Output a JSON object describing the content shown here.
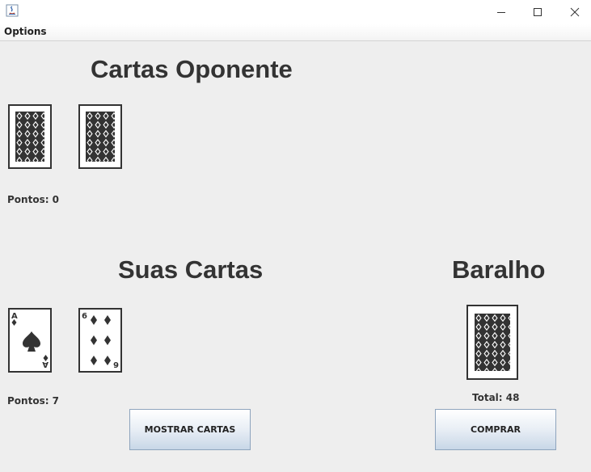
{
  "window": {
    "title": ""
  },
  "menubar": {
    "items": [
      "Options"
    ]
  },
  "opponent": {
    "heading": "Cartas Oponente",
    "cards": [
      "back",
      "back"
    ],
    "points_label": "Pontos: 0"
  },
  "player": {
    "heading": "Suas Cartas",
    "cards": [
      {
        "rank": "A",
        "suit": "spades"
      },
      {
        "rank": "6",
        "suit": "diamonds"
      }
    ],
    "points_label": "Pontos: 7",
    "show_button_label": "MOSTRAR CARTAS"
  },
  "deck": {
    "heading": "Baralho",
    "total_label": "Total: 48",
    "buy_button_label": "COMPRAR"
  },
  "colors": {
    "background": "#eeeeee",
    "card_ink": "#333333",
    "button_border": "#8ea4bd"
  },
  "icons": [
    "java-app-icon",
    "minimize-icon",
    "maximize-icon",
    "close-icon"
  ]
}
